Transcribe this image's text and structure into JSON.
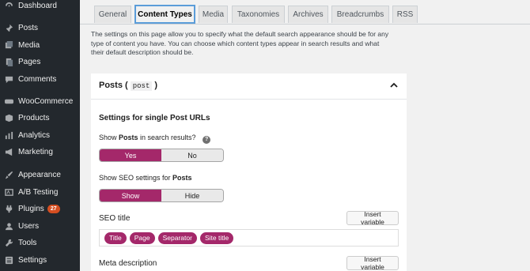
{
  "sidebar": {
    "items": [
      {
        "label": "Dashboard",
        "icon": "dashboard-icon"
      },
      {
        "label": "Posts",
        "icon": "pin-icon"
      },
      {
        "label": "Media",
        "icon": "media-icon"
      },
      {
        "label": "Pages",
        "icon": "pages-icon"
      },
      {
        "label": "Comments",
        "icon": "comments-icon"
      },
      {
        "label": "WooCommerce",
        "icon": "woocommerce-icon"
      },
      {
        "label": "Products",
        "icon": "products-icon"
      },
      {
        "label": "Analytics",
        "icon": "analytics-icon"
      },
      {
        "label": "Marketing",
        "icon": "megaphone-icon"
      },
      {
        "label": "Appearance",
        "icon": "brush-icon"
      },
      {
        "label": "A/B Testing",
        "icon": "ab-testing-icon"
      },
      {
        "label": "Plugins",
        "icon": "plugin-icon",
        "badge": "27"
      },
      {
        "label": "Users",
        "icon": "users-icon"
      },
      {
        "label": "Tools",
        "icon": "tools-icon"
      },
      {
        "label": "Settings",
        "icon": "settings-icon"
      }
    ]
  },
  "tabs": [
    "General",
    "Content Types",
    "Media",
    "Taxonomies",
    "Archives",
    "Breadcrumbs",
    "RSS"
  ],
  "active_tab": "Content Types",
  "intro": "The settings on this page allow you to specify what the default search appearance should be for any type of content you have. You can choose which content types appear in search results and what their default description should be.",
  "panel": {
    "title": "Posts (",
    "title_code": "post",
    "title_end": ")",
    "section_title": "Settings for single Post URLs",
    "show_in_search": {
      "label_prefix": "Show ",
      "label_bold": "Posts",
      "label_suffix": " in search results?",
      "help": "?",
      "options": [
        "Yes",
        "No"
      ],
      "selected": "Yes"
    },
    "show_seo": {
      "label_prefix": "Show SEO settings for ",
      "label_bold": "Posts",
      "options": [
        "Show",
        "Hide"
      ],
      "selected": "Show"
    },
    "seo_title": {
      "label": "SEO title",
      "insert_variable": "Insert variable",
      "variables": [
        "Title",
        "Page",
        "Separator",
        "Site title"
      ]
    },
    "meta_description": {
      "label": "Meta description",
      "insert_variable": "Insert variable"
    }
  },
  "colors": {
    "sidebar_bg": "#23282d",
    "accent": "#a4286a",
    "badge": "#d54e21",
    "active_tab_border": "#5b9dd9"
  }
}
